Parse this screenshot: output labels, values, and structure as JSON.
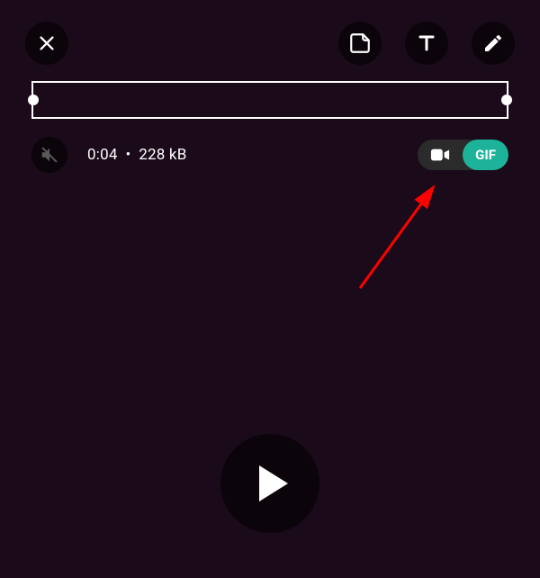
{
  "toolbar": {
    "close": "close-icon",
    "sticker": "sticker-icon",
    "text": "text-icon",
    "draw": "pencil-icon"
  },
  "info": {
    "duration": "0:04",
    "separator": "•",
    "size": "228 kB"
  },
  "toggle": {
    "gif_label": "GIF"
  },
  "colors": {
    "accent": "#1db39a",
    "muted_icon": "#5a5a5a"
  }
}
